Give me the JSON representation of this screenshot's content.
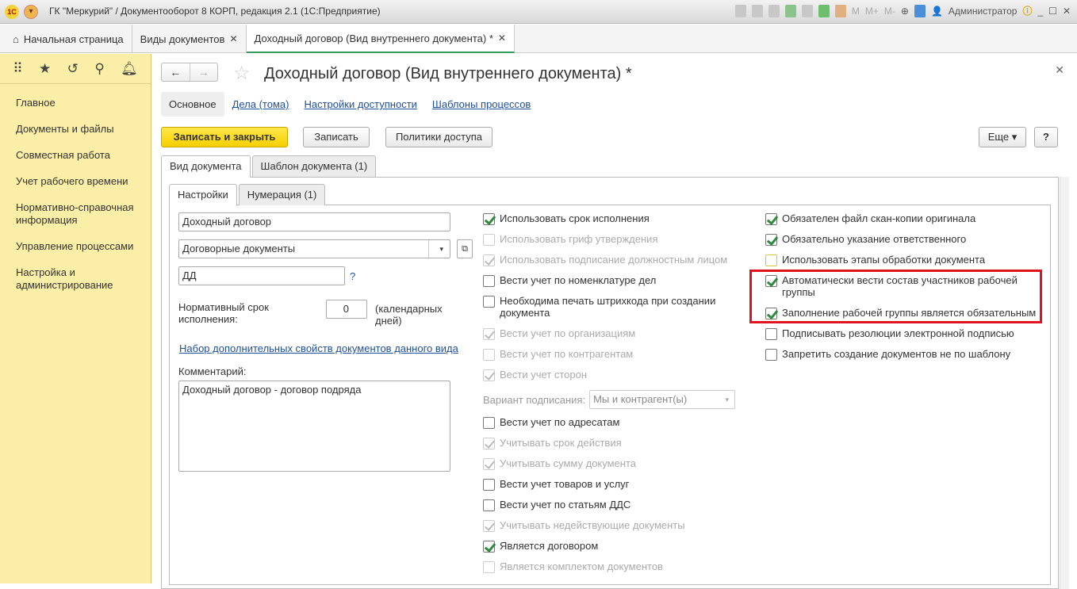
{
  "app": {
    "title": "ГК \"Меркурий\" / Документооборот 8 КОРП, редакция 2.1  (1С:Предприятие)",
    "user": "Администратор",
    "mem": [
      "M",
      "M+",
      "M-"
    ]
  },
  "tabs": [
    {
      "label": "Начальная страница"
    },
    {
      "label": "Виды документов"
    },
    {
      "label": "Доходный договор (Вид внутреннего документа) *"
    }
  ],
  "sidebar": {
    "items": [
      "Главное",
      "Документы и файлы",
      "Совместная работа",
      "Учет рабочего времени",
      "Нормативно-справочная информация",
      "Управление процессами",
      "Настройка и администрирование"
    ]
  },
  "form": {
    "title": "Доходный договор (Вид внутреннего документа) *",
    "subnav": {
      "current": "Основное",
      "links": [
        "Дела (тома)",
        "Настройки доступности",
        "Шаблоны процессов"
      ]
    },
    "buttons": {
      "save_close": "Записать и закрыть",
      "save": "Записать",
      "policies": "Политики доступа",
      "more": "Еще",
      "help": "?"
    },
    "page_tabs": [
      "Вид документа",
      "Шаблон документа (1)"
    ],
    "inner_tabs": [
      "Настройки",
      "Нумерация (1)"
    ],
    "name": "Доходный договор",
    "group": "Договорные документы",
    "prefix": "ДД",
    "prefix_help": "?",
    "term_label": "Нормативный срок исполнения:",
    "term_value": "0",
    "term_unit": "(календарных дней)",
    "props_link": "Набор дополнительных свойств документов данного вида",
    "comment_label": "Комментарий:",
    "comment": "Доходный договор - договор подряда",
    "sign_label": "Вариант подписания:",
    "sign_value": "Мы и контрагент(ы)"
  },
  "left_checks": [
    {
      "label": "Использовать срок исполнения",
      "checked": true,
      "disabled": false
    },
    {
      "label": "Использовать гриф утверждения",
      "checked": false,
      "disabled": true
    },
    {
      "label": "Использовать подписание должностным лицом",
      "checked": true,
      "disabled": true
    },
    {
      "label": "Вести учет по номенклатуре дел",
      "checked": false,
      "disabled": false
    },
    {
      "label": "Необходима печать штрихкода при создании документа",
      "checked": false,
      "disabled": false,
      "two": true
    },
    {
      "label": "Вести учет по организациям",
      "checked": true,
      "disabled": true
    },
    {
      "label": "Вести учет по контрагентам",
      "checked": false,
      "disabled": true
    },
    {
      "label": "Вести учет сторон",
      "checked": true,
      "disabled": true
    }
  ],
  "left_checks2": [
    {
      "label": "Вести учет по адресатам",
      "checked": false,
      "disabled": false
    },
    {
      "label": "Учитывать срок действия",
      "checked": true,
      "disabled": true
    },
    {
      "label": "Учитывать сумму документа",
      "checked": true,
      "disabled": true
    },
    {
      "label": "Вести учет товаров и услуг",
      "checked": false,
      "disabled": false
    },
    {
      "label": "Вести учет по статьям ДДС",
      "checked": false,
      "disabled": false
    },
    {
      "label": "Учитывать недействующие документы",
      "checked": true,
      "disabled": true
    },
    {
      "label": "Является договором",
      "checked": true,
      "disabled": false
    },
    {
      "label": "Является комплектом документов",
      "checked": false,
      "disabled": true
    }
  ],
  "right_checks": [
    {
      "label": "Обязателен файл скан-копии оригинала",
      "checked": true,
      "disabled": false
    },
    {
      "label": "Обязательно указание ответственного",
      "checked": true,
      "disabled": false
    },
    {
      "label": "Использовать этапы обработки документа",
      "checked": false,
      "disabled": false,
      "focus": true
    },
    {
      "label": "Автоматически вести состав участников рабочей группы",
      "checked": true,
      "disabled": false,
      "two": true
    },
    {
      "label": "Заполнение рабочей группы является обязательным",
      "checked": true,
      "disabled": false
    },
    {
      "label": "Подписывать резолюции электронной подписью",
      "checked": false,
      "disabled": false
    },
    {
      "label": "Запретить создание документов не по шаблону",
      "checked": false,
      "disabled": false
    }
  ],
  "colors": {
    "accent": "#f6cf00",
    "sidebar": "#fbeea6",
    "highlight": "#e0141e",
    "check": "#2e8b3e"
  }
}
